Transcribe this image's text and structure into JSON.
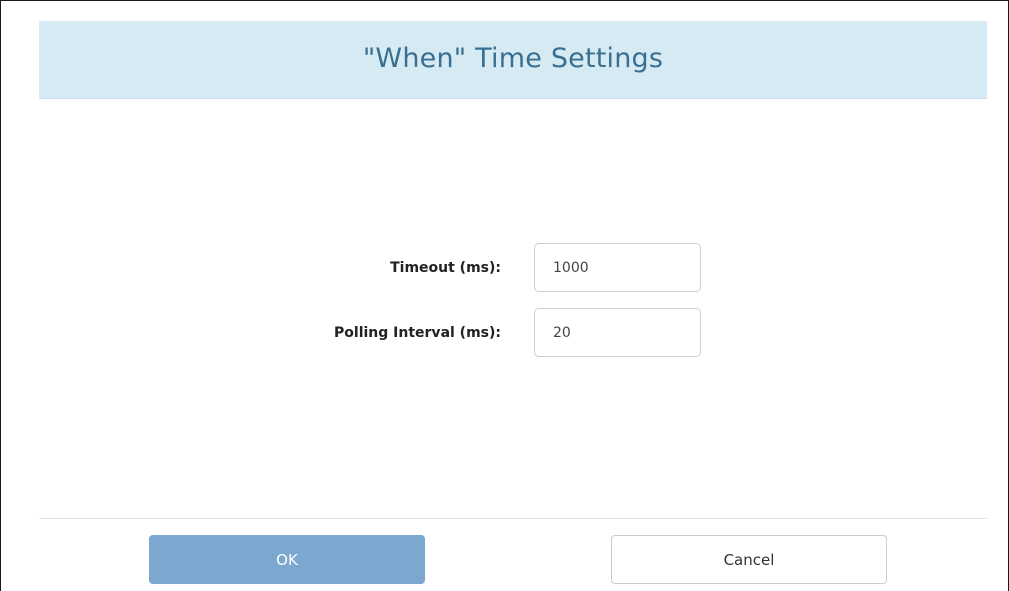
{
  "dialog": {
    "title": "\"When\" Time Settings"
  },
  "form": {
    "timeout": {
      "label": "Timeout (ms):",
      "value": "1000"
    },
    "polling_interval": {
      "label": "Polling Interval (ms):",
      "value": "20"
    }
  },
  "footer": {
    "ok_label": "OK",
    "cancel_label": "Cancel"
  },
  "colors": {
    "header_bg": "#d6eaf4",
    "title": "#3a6f91",
    "primary_button": "#7ca7cf"
  }
}
